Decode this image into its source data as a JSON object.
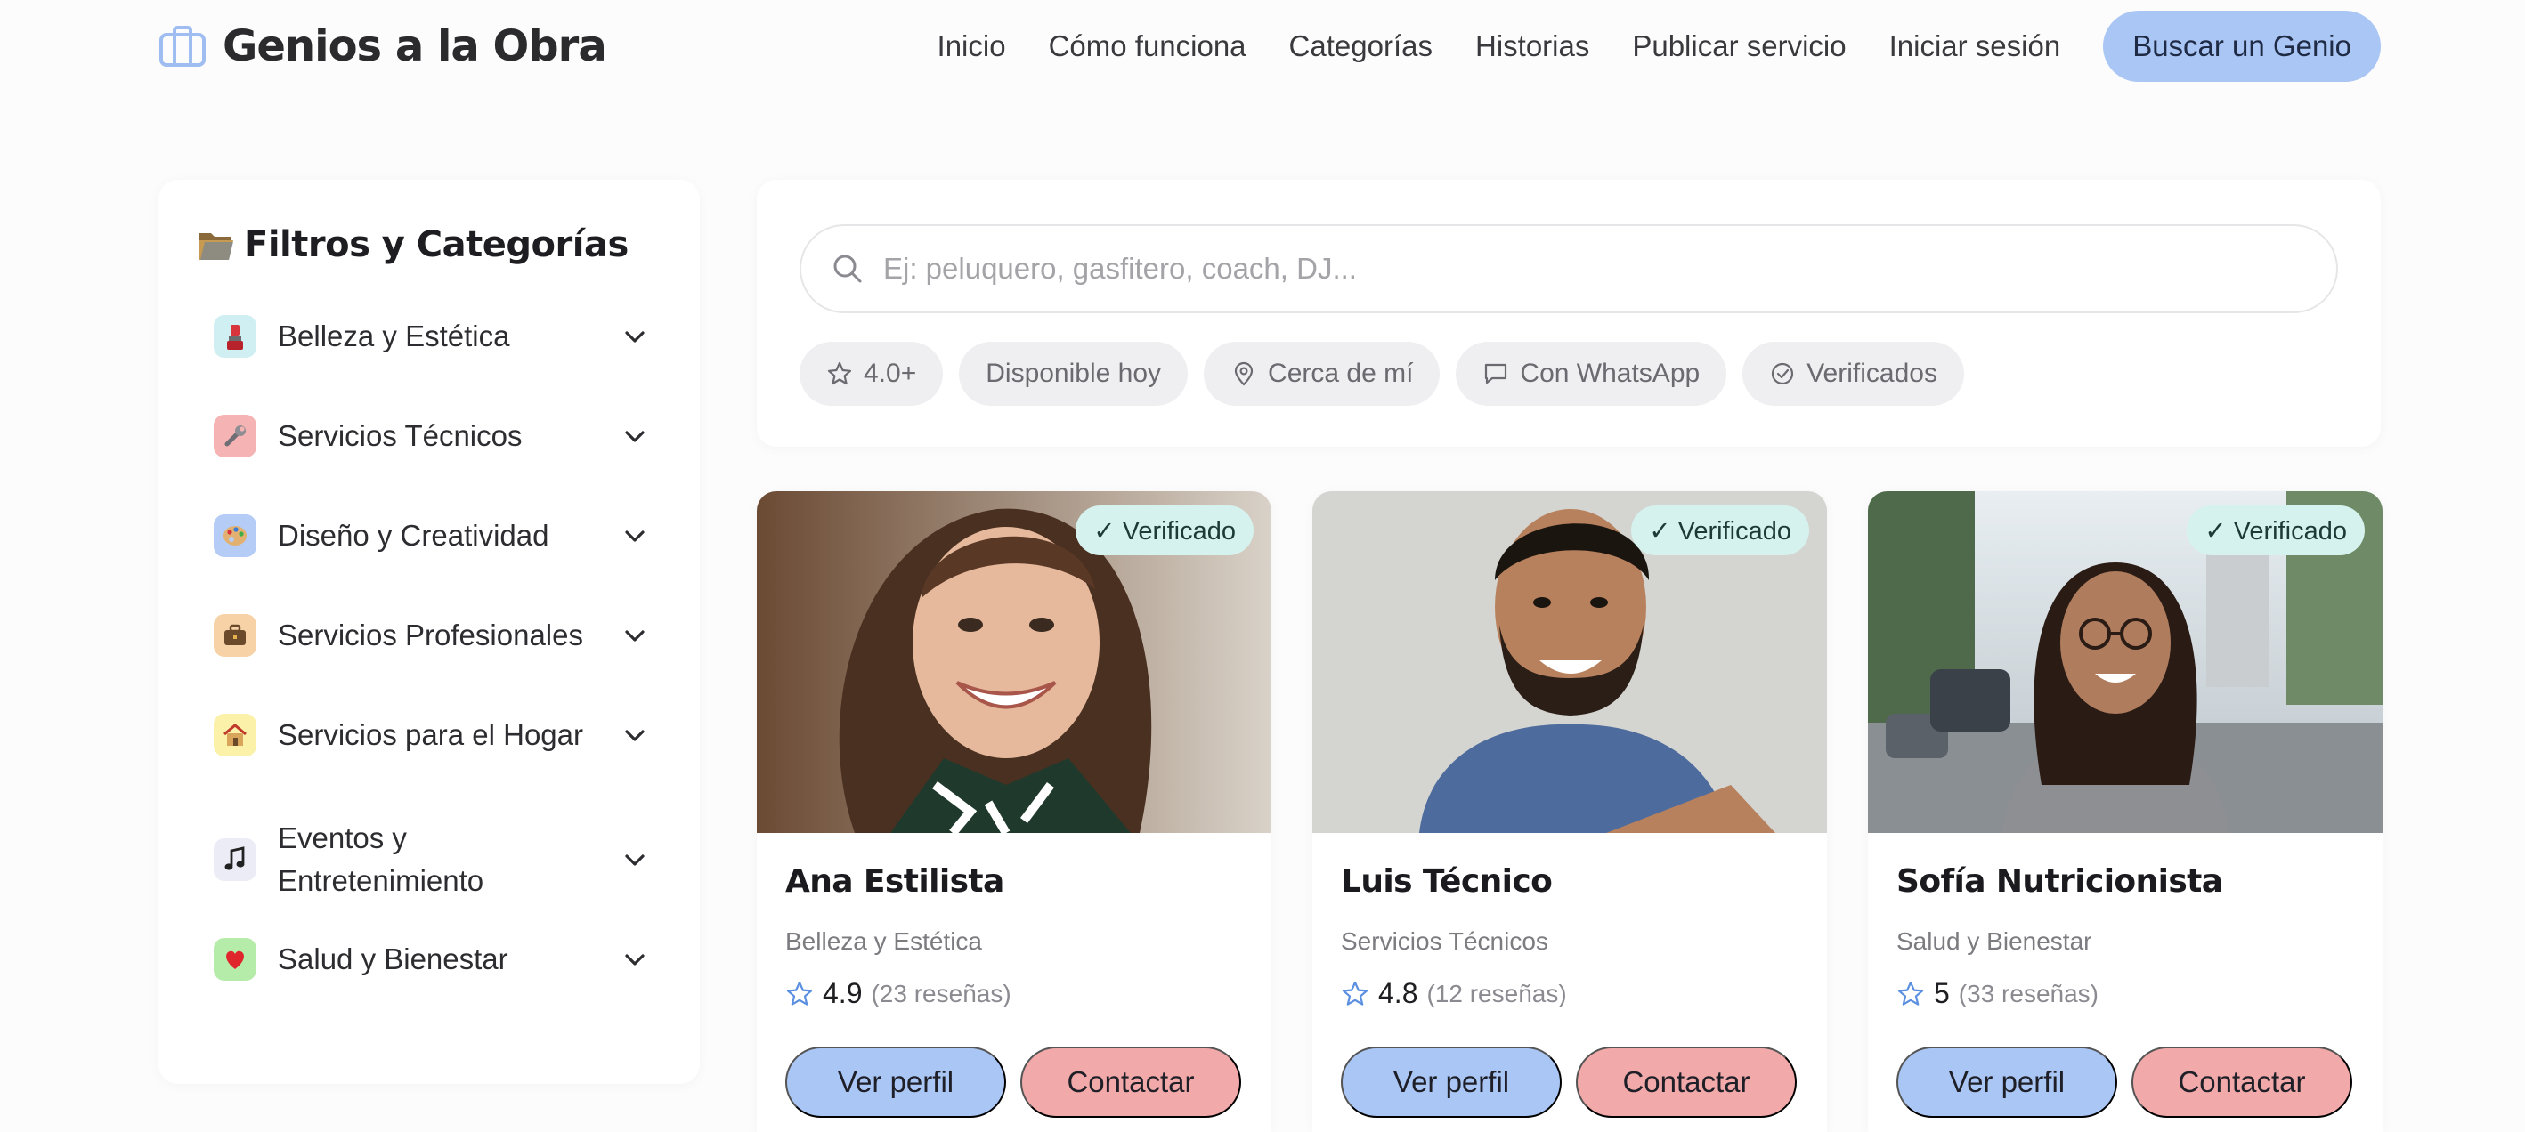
{
  "header": {
    "brand": "Genios a la Obra",
    "nav": [
      "Inicio",
      "Cómo funciona",
      "Categorías",
      "Historias",
      "Publicar servicio",
      "Iniciar sesión"
    ],
    "cta": "Buscar un Genio"
  },
  "sidebar": {
    "title": "Filtros y Categorías",
    "categories": [
      {
        "label": "Belleza y Estética",
        "icon": "lipstick-icon",
        "color": "#cfeff3"
      },
      {
        "label": "Servicios Técnicos",
        "icon": "wrench-icon",
        "color": "#f6b3b3"
      },
      {
        "label": "Diseño y Creatividad",
        "icon": "palette-icon",
        "color": "#b4ccf6"
      },
      {
        "label": "Servicios Profesionales",
        "icon": "briefcase-icon",
        "color": "#f7d2a6"
      },
      {
        "label": "Servicios para el Hogar",
        "icon": "house-icon",
        "color": "#fbf1a8"
      },
      {
        "label": "Eventos y Entretenimiento",
        "icon": "music-note-icon",
        "color": "#ececf7"
      },
      {
        "label": "Salud y Bienestar",
        "icon": "heart-icon",
        "color": "#b6ecaa"
      }
    ]
  },
  "search": {
    "placeholder": "Ej: peluquero, gasfitero, coach, DJ...",
    "value": ""
  },
  "filters": [
    "4.0+",
    "Disponible hoy",
    "Cerca de mí",
    "Con WhatsApp",
    "Verificados"
  ],
  "cards": [
    {
      "name": "Ana Estilista",
      "category": "Belleza y Estética",
      "rating": "4.9",
      "reviews": "(23 reseñas)",
      "badge": "✓ Verificado",
      "profile_label": "Ver perfil",
      "contact_label": "Contactar"
    },
    {
      "name": "Luis Técnico",
      "category": "Servicios Técnicos",
      "rating": "4.8",
      "reviews": "(12 reseñas)",
      "badge": "✓ Verificado",
      "profile_label": "Ver perfil",
      "contact_label": "Contactar"
    },
    {
      "name": "Sofía Nutricionista",
      "category": "Salud y Bienestar",
      "rating": "5",
      "reviews": "(33 reseñas)",
      "badge": "✓ Verificado",
      "profile_label": "Ver perfil",
      "contact_label": "Contactar"
    }
  ],
  "colors": {
    "accent_blue": "#a9c6f5",
    "accent_red": "#f1a9a9",
    "verified_bg": "#d5f2ee",
    "star": "#5b8fe0"
  }
}
